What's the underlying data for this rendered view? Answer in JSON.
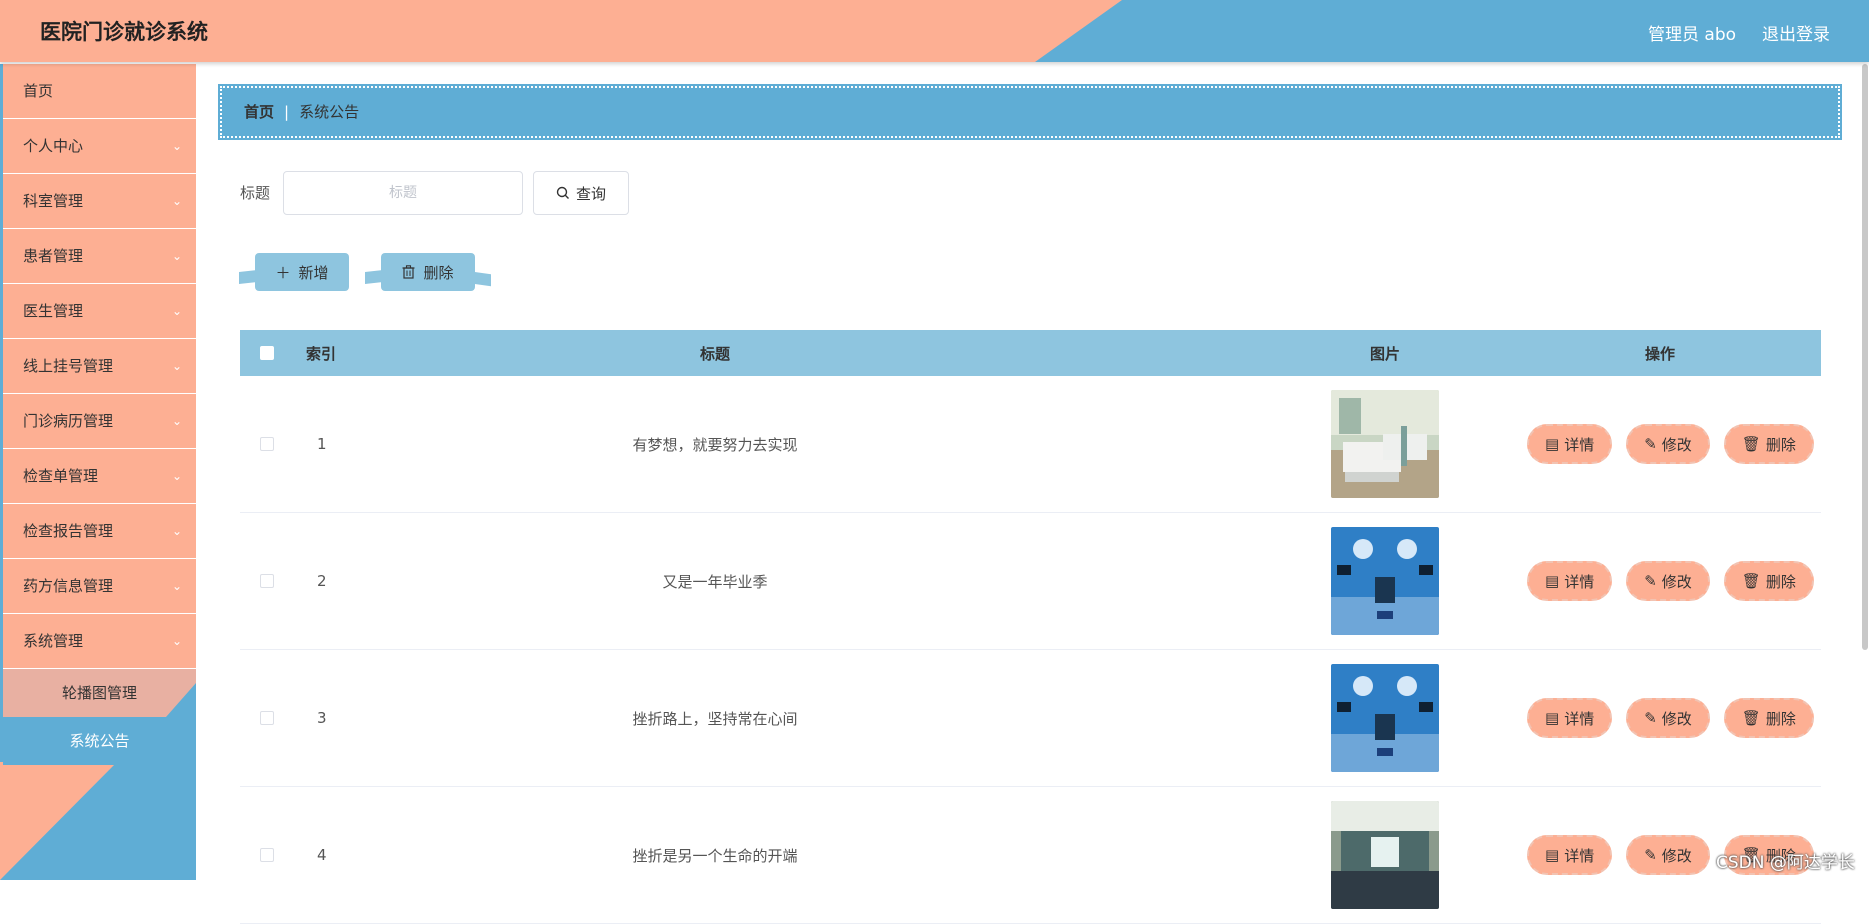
{
  "header": {
    "title": "医院门诊就诊系统",
    "user": "管理员 abo",
    "logout": "退出登录",
    "colors": {
      "salmon": "#fdaf93",
      "blue": "#5fadd5"
    }
  },
  "sidebar": {
    "items": [
      {
        "label": "首页",
        "chevron": ""
      },
      {
        "label": "个人中心",
        "chevron": "⌄"
      },
      {
        "label": "科室管理",
        "chevron": "⌄"
      },
      {
        "label": "患者管理",
        "chevron": "⌄"
      },
      {
        "label": "医生管理",
        "chevron": "⌄"
      },
      {
        "label": "线上挂号管理",
        "chevron": "⌄"
      },
      {
        "label": "门诊病历管理",
        "chevron": "⌄"
      },
      {
        "label": "检查单管理",
        "chevron": "⌄"
      },
      {
        "label": "检查报告管理",
        "chevron": "⌄"
      },
      {
        "label": "药方信息管理",
        "chevron": "⌄"
      },
      {
        "label": "系统管理",
        "chevron": "⌄"
      }
    ],
    "submenu": [
      {
        "label": "轮播图管理"
      },
      {
        "label": "系统公告"
      }
    ]
  },
  "breadcrumb": {
    "home": "首页",
    "separator": "|",
    "current": "系统公告"
  },
  "search": {
    "label": "标题",
    "placeholder": "标题",
    "value": "",
    "button": "查询"
  },
  "actions": {
    "add": "新增",
    "delete": "删除"
  },
  "table": {
    "headers": {
      "index": "索引",
      "title": "标题",
      "image": "图片",
      "ops": "操作"
    },
    "rows": [
      {
        "index": "1",
        "title": "有梦想，就要努力去实现",
        "image": "hospital-ward-photo"
      },
      {
        "index": "2",
        "title": "又是一年毕业季",
        "image": "operating-room-photo"
      },
      {
        "index": "3",
        "title": "挫折路上，坚持常在心间",
        "image": "operating-room-photo"
      },
      {
        "index": "4",
        "title": "挫折是另一个生命的开端",
        "image": "hospital-corridor-photo"
      }
    ],
    "ops": {
      "detail": "详情",
      "edit": "修改",
      "delete": "删除"
    }
  },
  "watermark": "CSDN @阿达学长"
}
